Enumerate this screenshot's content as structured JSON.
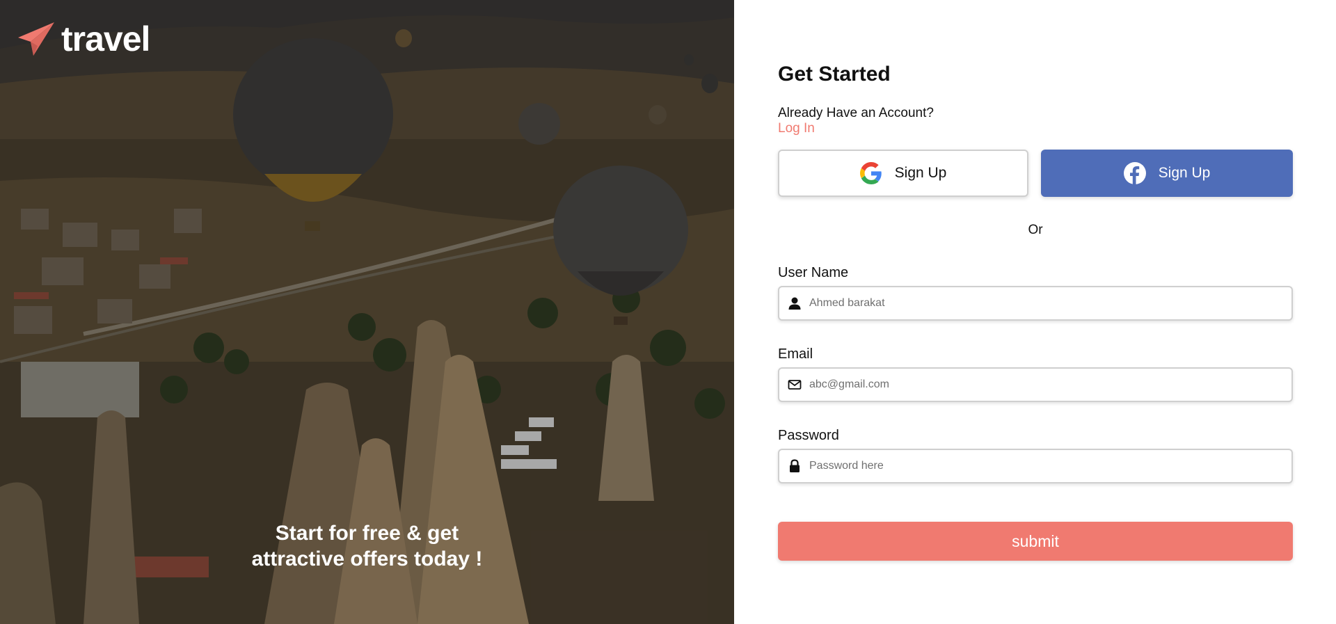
{
  "brand": {
    "name": "travel",
    "accent": "#f07a70"
  },
  "hero": {
    "tagline_line1": "Start for free & get",
    "tagline_line2": "attractive offers today !"
  },
  "form": {
    "title": "Get Started",
    "have_account": "Already Have an Account?",
    "login_link": "Log In",
    "google_label": "Sign Up",
    "facebook_label": "Sign Up",
    "facebook_color": "#4f6db8",
    "or_text": "Or",
    "username": {
      "label": "User Name",
      "placeholder": "Ahmed barakat",
      "icon": "user-icon"
    },
    "email": {
      "label": "Email",
      "placeholder": "abc@gmail.com",
      "icon": "envelope-icon"
    },
    "password": {
      "label": "Password",
      "placeholder": "Password here",
      "icon": "lock-icon"
    },
    "submit_label": "submit"
  }
}
